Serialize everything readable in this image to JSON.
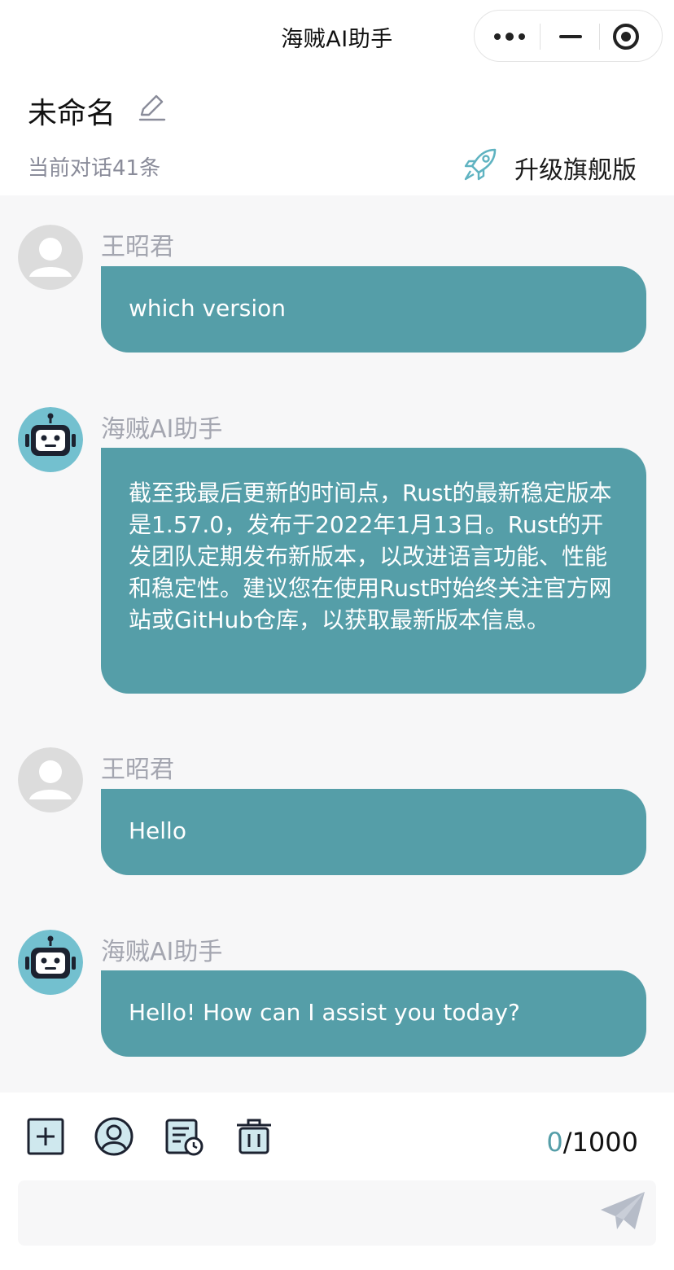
{
  "navbar": {
    "title": "海贼AI助手",
    "capsule": {
      "more_icon": "more-dots-icon",
      "minimize_icon": "minimize-icon",
      "close_icon": "close-circle-icon"
    }
  },
  "chat_header": {
    "title": "未命名",
    "edit_icon": "pencil-edit-icon",
    "count_text": "当前对话41条",
    "upgrade_icon": "rocket-icon",
    "upgrade_label": "升级旗舰版"
  },
  "colors": {
    "bubble": "#559ea8",
    "background": "#f7f7f8",
    "accent": "#559ea8"
  },
  "messages": [
    {
      "role": "user",
      "sender": "王昭君",
      "avatar": "user-avatar-icon",
      "text": "which version"
    },
    {
      "role": "assistant",
      "sender": "海贼AI助手",
      "avatar": "robot-avatar-icon",
      "text": "截至我最后更新的时间点，Rust的最新稳定版本是1.57.0，发布于2022年1月13日。Rust的开发团队定期发布新版本，以改进语言功能、性能和稳定性。建议您在使用Rust时始终关注官方网站或GitHub仓库，以获取最新版本信息。"
    },
    {
      "role": "user",
      "sender": "王昭君",
      "avatar": "user-avatar-icon",
      "text": "Hello"
    },
    {
      "role": "assistant",
      "sender": "海贼AI助手",
      "avatar": "robot-avatar-icon",
      "text": "Hello! How can I assist you today?"
    }
  ],
  "toolbar": {
    "tools": [
      "new-chat-icon",
      "role-select-icon",
      "history-icon",
      "delete-icon"
    ],
    "char_count": "0",
    "char_max": "/1000",
    "input_placeholder": "",
    "send_icon": "send-paper-plane-icon"
  }
}
